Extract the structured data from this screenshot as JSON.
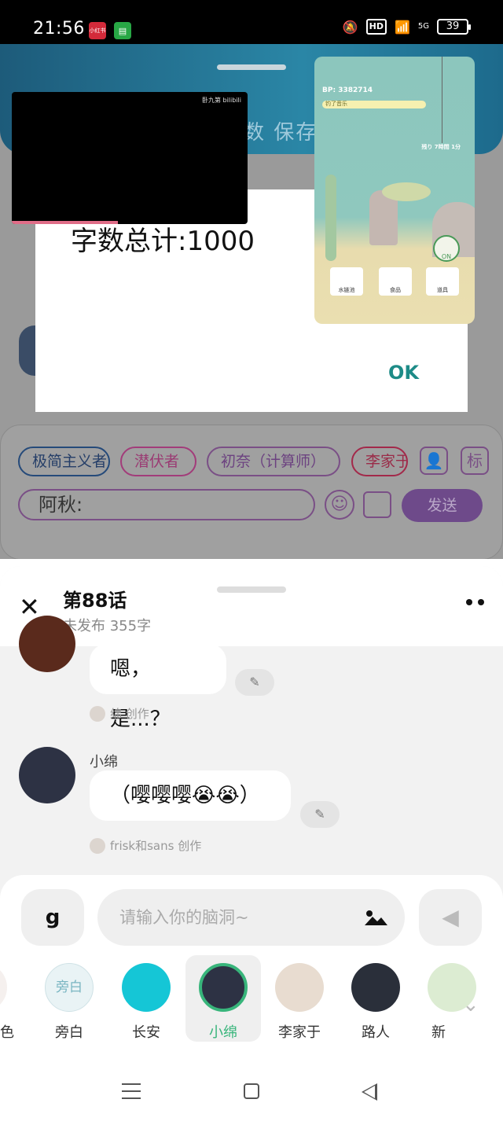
{
  "status_bar": {
    "time": "21:56",
    "app1": "小红书",
    "app2": "▤",
    "hd": "HD",
    "signal": "5G",
    "battery": "39"
  },
  "top_app": {
    "header_text": "数  保存",
    "dialog": {
      "message": "字数总计:1000",
      "ok_label": "OK"
    },
    "video": {
      "brand": "卧九第 bilibili"
    },
    "game": {
      "bp": "BP: 3382714",
      "bar_text": "钓了音乐",
      "timer": "残り 7時間 1分",
      "on_label": "ON",
      "buttons": [
        "水链池",
        "食品",
        "道具"
      ]
    },
    "chips": [
      "极简主义者",
      "潜伏者",
      "初奈（计算师）",
      "李家于"
    ],
    "tag_button": "标",
    "chat_input": "阿秋:",
    "send_label": "发送"
  },
  "sheet": {
    "title": "第88话",
    "subtitle": "未发布 355字",
    "messages": [
      {
        "text": "嗯，是...？",
        "credit": "绵 创作"
      },
      {
        "name": "小绵",
        "text": "（嘤嘤嘤😭😭）",
        "credit": "frisk和sans 创作"
      }
    ],
    "composer_placeholder": "请输入你的脑洞~",
    "roles": [
      {
        "label": "角色",
        "color": "#f5f0ee"
      },
      {
        "label": "旁白",
        "color": "#e9f3f5",
        "inner": "旁白"
      },
      {
        "label": "长安",
        "color": "#15c6d6"
      },
      {
        "label": "小绵",
        "color": "#2d3244"
      },
      {
        "label": "李家于",
        "color": "#e8dcd0"
      },
      {
        "label": "路人",
        "color": "#2a2f3a"
      },
      {
        "label": "新",
        "color": "#dcecd2"
      }
    ]
  }
}
